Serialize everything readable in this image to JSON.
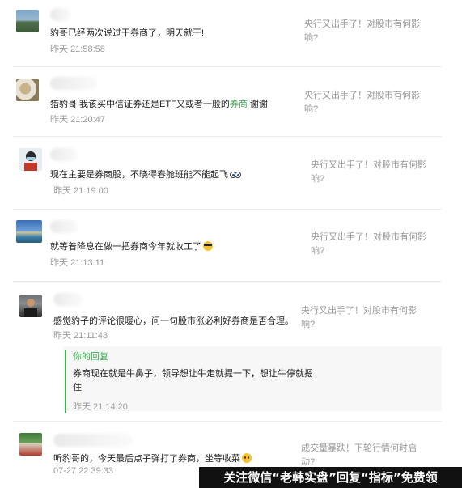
{
  "comments": [
    {
      "text": "豹哥已经两次说过干券商了，明天就干!",
      "time": "昨天 21:58:58",
      "article": "央行又出手了！对股市有何影响?"
    },
    {
      "text_before": "猎豹哥  我该买中信证券还是ETF又或者一般的",
      "text_highlight": "券商",
      "text_after": " 谢谢",
      "time": "昨天 21:20:47",
      "article": "央行又出手了！对股市有何影响?"
    },
    {
      "text": "现在主要是券商股，不晓得春舱班能不能起飞",
      "time": "昨天 21:19:00",
      "article": "央行又出手了！对股市有何影响?",
      "emoji": "eyes-emoji"
    },
    {
      "text": "就等着降息在做一把券商今年就收工了",
      "time": "昨天 21:13:11",
      "article": "央行又出手了！对股市有何影响?",
      "emoji": "sunglasses-emoji"
    },
    {
      "text": "感觉豹子的评论很暖心，问一句股市涨必利好券商是否合理。",
      "time": "昨天 21:11:48",
      "article": "央行又出手了！对股市有何影响?",
      "reply": {
        "header": "你的回复",
        "text": "券商现在就是牛鼻子，领导想让牛走就提一下，想让牛停就摁住",
        "time": "昨天 21:14:20"
      }
    },
    {
      "text": "听豹哥的，今天最后点子弹打了券商，坐等收菜",
      "time": "07-27 22:39:33",
      "article": "成交量暴跌！下轮行情何时启动?",
      "emoji": "tearful-smile-emoji"
    }
  ],
  "banner": "关注微信“老韩实盘”回复“指标”免费领"
}
